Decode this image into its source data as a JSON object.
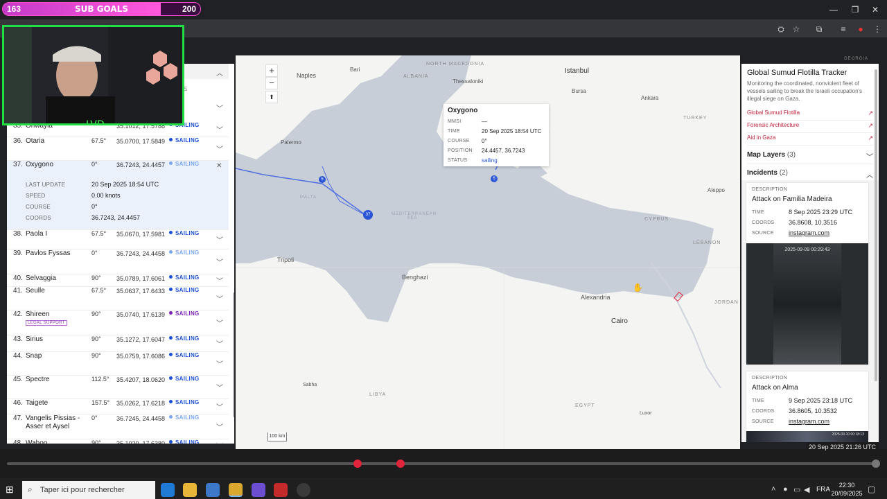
{
  "subgoals": {
    "current": "163",
    "label": "SUB GOALS",
    "target": "200"
  },
  "browser": {
    "window_controls": {
      "minimize": "—",
      "restore": "❐",
      "close": "✕"
    }
  },
  "vessels_list": {
    "rows": [
      {
        "num": "35.",
        "name": "Ohwayla",
        "course": "",
        "coords": "35.1012, 17.5788",
        "status": "SAILING",
        "status_color": "#1a4fd6"
      },
      {
        "num": "36.",
        "name": "Otaria",
        "course": "67.5°",
        "coords": "35.0700, 17.5849",
        "status": "SAILING",
        "status_color": "#1a4fd6"
      },
      {
        "num": "37.",
        "name": "Oxygono",
        "course": "0°",
        "coords": "36.7243, 24.4457",
        "status": "SAILING",
        "status_color": "#7aa7f0"
      },
      {
        "num": "38.",
        "name": "Paola I",
        "course": "67.5°",
        "coords": "35.0670, 17.5981",
        "status": "SAILING",
        "status_color": "#1a4fd6"
      },
      {
        "num": "39.",
        "name": "Pavlos Fyssas",
        "course": "0°",
        "coords": "36.7243, 24.4458",
        "status": "SAILING",
        "status_color": "#7aa7f0"
      },
      {
        "num": "40.",
        "name": "Selvaggia",
        "course": "90°",
        "coords": "35.0789, 17.6061",
        "status": "SAILING",
        "status_color": "#1a4fd6"
      },
      {
        "num": "41.",
        "name": "Seulle",
        "course": "67.5°",
        "coords": "35.0637, 17.6433",
        "status": "SAILING",
        "status_color": "#1a4fd6"
      },
      {
        "num": "42.",
        "name": "Shireen",
        "course": "90°",
        "coords": "35.0740, 17.6139",
        "status": "SAILING",
        "status_color": "#7d1fb5"
      },
      {
        "num": "43.",
        "name": "Sirius",
        "course": "90°",
        "coords": "35.1272, 17.6047",
        "status": "SAILING",
        "status_color": "#1a4fd6"
      },
      {
        "num": "44.",
        "name": "Snap",
        "course": "90°",
        "coords": "35.0759, 17.6086",
        "status": "SAILING",
        "status_color": "#1a4fd6"
      },
      {
        "num": "45.",
        "name": "Spectre",
        "course": "112.5°",
        "coords": "35.4207, 18.0620",
        "status": "SAILING",
        "status_color": "#1a4fd6"
      },
      {
        "num": "46.",
        "name": "Taigete",
        "course": "157.5°",
        "coords": "35.0262, 17.6218",
        "status": "SAILING",
        "status_color": "#1a4fd6"
      },
      {
        "num": "47.",
        "name": "Vangelis Pissias - Asser et Aysel",
        "course": "0°",
        "coords": "36.7245, 24.4458",
        "status": "SAILING",
        "status_color": "#7aa7f0"
      },
      {
        "num": "48.",
        "name": "Wahoo",
        "course": "90°",
        "coords": "35.1020, 17.6380",
        "status": "SAILING",
        "status_color": "#1a4fd6"
      }
    ],
    "shireen_badge": "LEGAL SUPPORT",
    "expanded": {
      "last_update_label": "LAST UPDATE",
      "last_update": "20 Sep 2025 18:54 UTC",
      "speed_label": "SPEED",
      "speed": "0.00 knots",
      "course_label": "COURSE",
      "course": "0°",
      "coords_label": "COORDS",
      "coords": "36.7243, 24.4457"
    },
    "header_fragment": "S"
  },
  "map": {
    "zoom_in": "+",
    "zoom_out": "−",
    "compass": "⬆",
    "scale": "100 km",
    "labels": {
      "naples": "Naples",
      "bari": "Bari",
      "istanbul": "Istanbul",
      "bursa": "Bursa",
      "ankara": "Ankara",
      "thessaloniki": "Thessaloniki",
      "palermo": "Palermo",
      "tripoli": "Tripoli",
      "benghazi": "Benghazi",
      "alexandria": "Alexandria",
      "cairo": "Cairo",
      "aleppo": "Aleppo",
      "sabha": "Sabha",
      "luxor": "Luxor",
      "north_macedonia": "NORTH MACEDONIA",
      "albania": "ALBANIA",
      "turkey": "TURKEY",
      "cyprus": "CYPRUS",
      "lebanon": "LEBANON",
      "jordan": "JORDAN",
      "libya": "LIBYA",
      "egypt": "EGYPT",
      "georgia": "GEORGIA",
      "med_sea": "MEDITERRANEAN SEA",
      "malta": "MALTA",
      "izmir_frag": "ir"
    },
    "markers": {
      "m5": "5",
      "m6": "6",
      "m37": "37"
    }
  },
  "popup": {
    "title": "Oxygono",
    "mmsi_label": "MMSI",
    "mmsi": "—",
    "time_label": "TIME",
    "time": "20 Sep 2025 18:54 UTC",
    "course_label": "COURSE",
    "course": "0°",
    "position_label": "POSITION",
    "position": "24.4457, 36.7243",
    "status_label": "STATUS",
    "status": "sailing"
  },
  "tracker": {
    "title": "Global Sumud Flotilla Tracker",
    "description": "Monitoring the coordinated, nonviolent fleet of vessels sailing to break the Israeli occupation's illegal siege on Gaza.",
    "links": [
      "Global Sumud Flotilla",
      "Forensic Architecture",
      "Aid in Gaza"
    ],
    "link_arrow": "↗",
    "map_layers_label": "Map Layers",
    "map_layers_count": "(3)",
    "incidents_label": "Incidents",
    "incidents_count": "(2)",
    "incidents": [
      {
        "description_label": "DESCRIPTION",
        "description": "Attack on Familia Madeira",
        "time_label": "TIME",
        "time": "8 Sep 2025 23:29 UTC",
        "coords_label": "COORDS",
        "coords": "36.8608, 10.3516",
        "source_label": "SOURCE",
        "source": "instagram.com",
        "image_timestamp": "2025-09-09 00:29:43"
      },
      {
        "description_label": "DESCRIPTION",
        "description": "Attack on Alma",
        "time_label": "TIME",
        "time": "9 Sep 2025 23:18 UTC",
        "coords_label": "COORDS",
        "coords": "36.8605, 10.3532",
        "source_label": "SOURCE",
        "source": "instagram.com",
        "image_timestamp": "2025-09-10 00:18:13"
      }
    ]
  },
  "timeline": {
    "current": "20 Sep 2025 21:26 UTC"
  },
  "taskbar": {
    "search_placeholder": "Taper ici pour rechercher",
    "language": "FRA",
    "time": "22:30",
    "date": "20/09/2025"
  }
}
